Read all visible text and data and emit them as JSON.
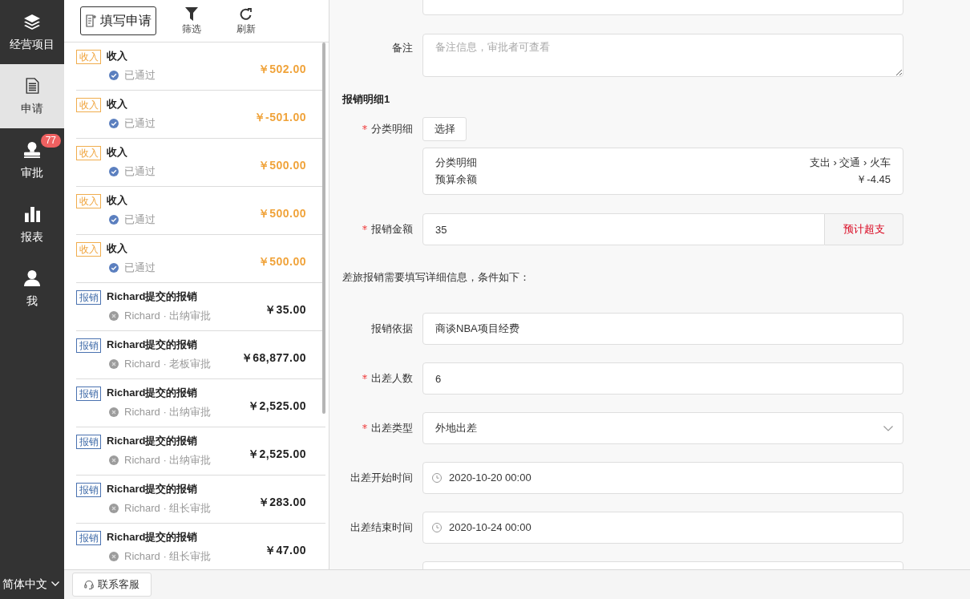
{
  "sidebar": {
    "items": [
      {
        "label": "经营项目",
        "selected": false
      },
      {
        "label": "申请",
        "selected": true
      },
      {
        "label": "审批",
        "selected": false,
        "badge": "77"
      },
      {
        "label": "报表",
        "selected": false
      },
      {
        "label": "我",
        "selected": false
      }
    ],
    "language": "简体中文"
  },
  "list_toolbar": {
    "new_button": "填写申请",
    "filter_button": "筛选",
    "refresh_button": "刷新"
  },
  "records": [
    {
      "kind": "income",
      "tag": "收入",
      "title": "收入",
      "status": "已通过",
      "amount": "￥502.00"
    },
    {
      "kind": "income",
      "tag": "收入",
      "title": "收入",
      "status": "已通过",
      "amount": "￥-501.00"
    },
    {
      "kind": "income",
      "tag": "收入",
      "title": "收入",
      "status": "已通过",
      "amount": "￥500.00"
    },
    {
      "kind": "income",
      "tag": "收入",
      "title": "收入",
      "status": "已通过",
      "amount": "￥500.00"
    },
    {
      "kind": "income",
      "tag": "收入",
      "title": "收入",
      "status": "已通过",
      "amount": "￥500.00"
    },
    {
      "kind": "expense",
      "tag": "报销",
      "title": "Richard提交的报销",
      "status": "Richard · 出纳审批",
      "amount": "￥35.00"
    },
    {
      "kind": "expense",
      "tag": "报销",
      "title": "Richard提交的报销",
      "status": "Richard · 老板审批",
      "amount": "￥68,877.00"
    },
    {
      "kind": "expense",
      "tag": "报销",
      "title": "Richard提交的报销",
      "status": "Richard · 出纳审批",
      "amount": "￥2,525.00"
    },
    {
      "kind": "expense",
      "tag": "报销",
      "title": "Richard提交的报销",
      "status": "Richard · 出纳审批",
      "amount": "￥2,525.00"
    },
    {
      "kind": "expense",
      "tag": "报销",
      "title": "Richard提交的报销",
      "status": "Richard · 组长审批",
      "amount": "￥283.00"
    },
    {
      "kind": "expense",
      "tag": "报销",
      "title": "Richard提交的报销",
      "status": "Richard · 组长审批",
      "amount": "￥47.00"
    }
  ],
  "form": {
    "remark": {
      "label": "备注",
      "placeholder": "备注信息，审批者可查看"
    },
    "section_title": "报销明细1",
    "category": {
      "label": "分类明细",
      "required": true,
      "button": "选择",
      "summary": [
        {
          "label": "分类明细",
          "value": "支出 › 交通 › 火车"
        },
        {
          "label": "预算余额",
          "value": "￥-4.45"
        }
      ]
    },
    "amount": {
      "label": "报销金额",
      "required": true,
      "value": "35",
      "addon": "预计超支"
    },
    "travel_note": "差旅报销需要填写详细信息，条件如下：",
    "travel_fields": [
      {
        "kind": "text",
        "label": "报销依据",
        "required": false,
        "value": "商谈NBA项目经费"
      },
      {
        "kind": "text",
        "label": "出差人数",
        "required": true,
        "value": "6"
      },
      {
        "kind": "select",
        "label": "出差类型",
        "required": true,
        "value": "外地出差"
      },
      {
        "kind": "datetime",
        "label": "出差开始时间",
        "required": false,
        "value": "2020-10-20 00:00"
      },
      {
        "kind": "datetime",
        "label": "出差结束时间",
        "required": false,
        "value": "2020-10-24 00:00"
      }
    ]
  },
  "footer": {
    "support_button": "联系客服"
  }
}
